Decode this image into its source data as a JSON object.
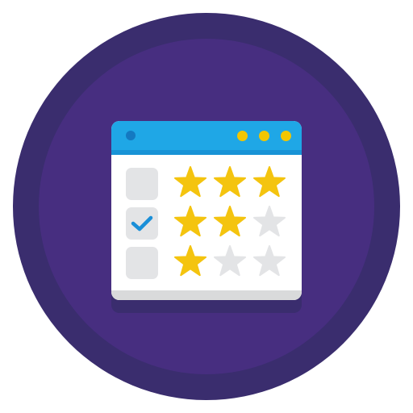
{
  "colors": {
    "badge_outer": "#3a2d6e",
    "badge_inner": "#472e80",
    "window_shadow": "#3a2d6e",
    "titlebar": "#1fa7e6",
    "titlebar_strip": "#1893d6",
    "menu_dot": "#1479c1",
    "control_dot": "#f2c600",
    "window_body": "#ffffff",
    "window_footer": "#d9dadb",
    "checkbox": "#e3e4e6",
    "checkmark": "#1a8fd8",
    "star_filled": "#f4c40f",
    "star_empty": "#e3e4e6"
  },
  "icons": {
    "window_menu": "menu-dot-icon",
    "window_controls": [
      "control-dot-icon",
      "control-dot-icon",
      "control-dot-icon"
    ],
    "check": "checkmark-icon",
    "star": "star-icon"
  },
  "ratings": [
    {
      "checked": false,
      "stars_filled": 3,
      "stars_total": 3
    },
    {
      "checked": true,
      "stars_filled": 2,
      "stars_total": 3
    },
    {
      "checked": false,
      "stars_filled": 1,
      "stars_total": 3
    }
  ]
}
